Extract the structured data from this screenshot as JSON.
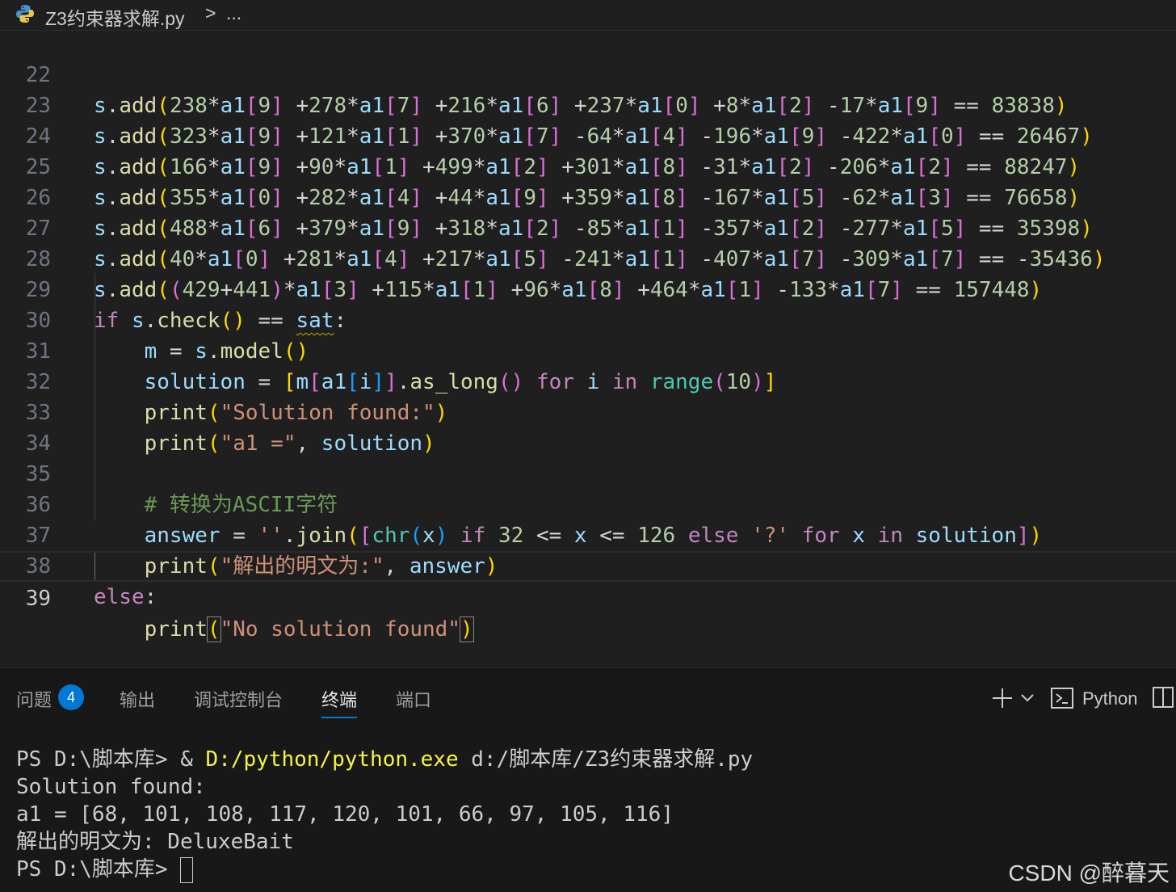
{
  "breadcrumb": {
    "file": "Z3约束器求解.py",
    "separator": ">",
    "more": "..."
  },
  "editor": {
    "lines": [
      {
        "num": "22",
        "text": "s.add(238*a1[9] +278*a1[7] +216*a1[6] +237*a1[0] +8*a1[2] -17*a1[9] == 83838)"
      },
      {
        "num": "23",
        "text": "s.add(323*a1[9] +121*a1[1] +370*a1[7] -64*a1[4] -196*a1[9] -422*a1[0] == 26467)"
      },
      {
        "num": "24",
        "text": "s.add(166*a1[9] +90*a1[1] +499*a1[2] +301*a1[8] -31*a1[2] -206*a1[2] == 88247)"
      },
      {
        "num": "25",
        "text": "s.add(355*a1[0] +282*a1[4] +44*a1[9] +359*a1[8] -167*a1[5] -62*a1[3] == 76658)"
      },
      {
        "num": "26",
        "text": "s.add(488*a1[6] +379*a1[9] +318*a1[2] -85*a1[1] -357*a1[2] -277*a1[5] == 35398)"
      },
      {
        "num": "27",
        "text": "s.add(40*a1[0] +281*a1[4] +217*a1[5] -241*a1[1] -407*a1[7] -309*a1[7] == -35436)"
      },
      {
        "num": "28",
        "text": "s.add((429+441)*a1[3] +115*a1[1] +96*a1[8] +464*a1[1] -133*a1[7] == 157448)"
      },
      {
        "num": "29",
        "text": "if s.check() == sat:"
      },
      {
        "num": "30",
        "text": "    m = s.model()"
      },
      {
        "num": "31",
        "text": "    solution = [m[a1[i]].as_long() for i in range(10)]"
      },
      {
        "num": "32",
        "text": "    print(\"Solution found:\")"
      },
      {
        "num": "33",
        "text": "    print(\"a1 =\", solution)"
      },
      {
        "num": "34",
        "text": ""
      },
      {
        "num": "35",
        "text": "    # 转换为ASCII字符"
      },
      {
        "num": "36",
        "text": "    answer = ''.join([chr(x) if 32 <= x <= 126 else '?' for x in solution])"
      },
      {
        "num": "37",
        "text": "    print(\"解出的明文为:\", answer)"
      },
      {
        "num": "38",
        "text": "else:"
      },
      {
        "num": "39",
        "text": "    print(\"No solution found\")"
      }
    ]
  },
  "panel": {
    "tabs": [
      {
        "label": "问题"
      },
      {
        "label": "输出"
      },
      {
        "label": "调试控制台"
      },
      {
        "label": "终端"
      },
      {
        "label": "端口"
      }
    ],
    "problems_count": "4",
    "active_tab": "终端",
    "terminal_profile": "Python",
    "terminal": {
      "prompt1": "PS D:\\脚本库> ",
      "amp": "& ",
      "exe": "D:/python/python.exe",
      "script": " d:/脚本库/Z3约束器求解.py",
      "out1": "Solution found:",
      "out2": "a1 = [68, 101, 108, 117, 120, 101, 66, 97, 105, 116]",
      "out3": "解出的明文为: DeluxeBait",
      "prompt2": "PS D:\\脚本库> "
    }
  },
  "watermark": "CSDN @醉暮天",
  "colors": {
    "accent": "#0078d4",
    "background": "#1f1f1f",
    "panel": "#181818"
  }
}
